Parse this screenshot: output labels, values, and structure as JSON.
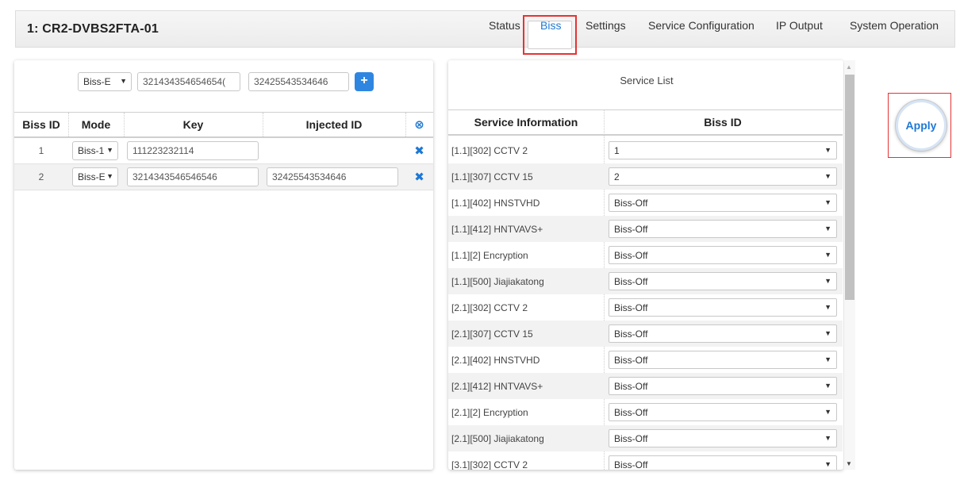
{
  "device_title": "1: CR2-DVBS2FTA-01",
  "tabs": [
    {
      "label": "Status"
    },
    {
      "label": "Biss"
    },
    {
      "label": "Settings"
    },
    {
      "label": "Service Configuration"
    },
    {
      "label": "IP Output"
    },
    {
      "label": "System Operation"
    }
  ],
  "add_form": {
    "mode": "Biss-E",
    "key": "321434354654654(",
    "injected_id": "32425543534646",
    "add_label": "+"
  },
  "biss_table": {
    "headers": {
      "id": "Biss ID",
      "mode": "Mode",
      "key": "Key",
      "injected": "Injected ID"
    },
    "rows": [
      {
        "id": "1",
        "mode": "Biss-1",
        "key": "111223232114",
        "injected": ""
      },
      {
        "id": "2",
        "mode": "Biss-E",
        "key": "3214343546546546",
        "injected": "32425543534646"
      }
    ]
  },
  "service_list": {
    "title": "Service List",
    "headers": {
      "info": "Service Information",
      "biss": "Biss ID"
    },
    "rows": [
      {
        "info": "[1.1][302] CCTV 2",
        "biss": "1"
      },
      {
        "info": "[1.1][307] CCTV 15",
        "biss": "2"
      },
      {
        "info": "[1.1][402] HNSTVHD",
        "biss": "Biss-Off"
      },
      {
        "info": "[1.1][412] HNTVAVS+",
        "biss": "Biss-Off"
      },
      {
        "info": "[1.1][2] Encryption",
        "biss": "Biss-Off"
      },
      {
        "info": "[1.1][500] Jiajiakatong",
        "biss": "Biss-Off"
      },
      {
        "info": "[2.1][302] CCTV 2",
        "biss": "Biss-Off"
      },
      {
        "info": "[2.1][307] CCTV 15",
        "biss": "Biss-Off"
      },
      {
        "info": "[2.1][402] HNSTVHD",
        "biss": "Biss-Off"
      },
      {
        "info": "[2.1][412] HNTVAVS+",
        "biss": "Biss-Off"
      },
      {
        "info": "[2.1][2] Encryption",
        "biss": "Biss-Off"
      },
      {
        "info": "[2.1][500] Jiajiakatong",
        "biss": "Biss-Off"
      },
      {
        "info": "[3.1][302] CCTV 2",
        "biss": "Biss-Off"
      }
    ]
  },
  "apply_label": "Apply",
  "colors": {
    "accent": "#1e78d4",
    "highlight": "#e53333"
  }
}
